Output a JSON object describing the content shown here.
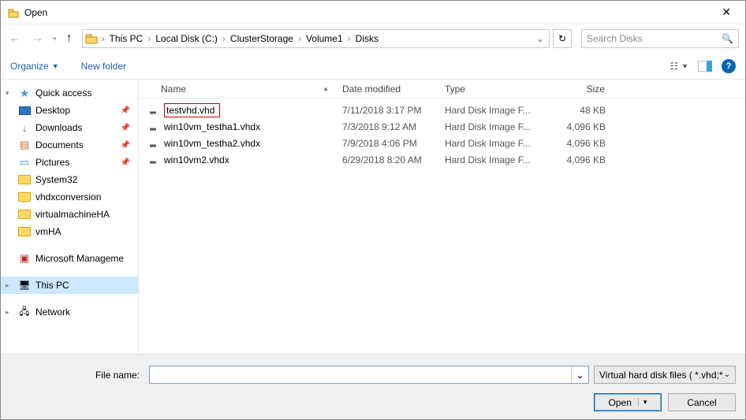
{
  "window": {
    "title": "Open"
  },
  "breadcrumb": [
    "This PC",
    "Local Disk (C:)",
    "ClusterStorage",
    "Volume1",
    "Disks"
  ],
  "search": {
    "placeholder": "Search Disks"
  },
  "toolbar": {
    "organize": "Organize",
    "newfolder": "New folder"
  },
  "tree": {
    "quick": {
      "label": "Quick access"
    },
    "desktop": {
      "label": "Desktop"
    },
    "downloads": {
      "label": "Downloads"
    },
    "documents": {
      "label": "Documents"
    },
    "pictures": {
      "label": "Pictures"
    },
    "system32": {
      "label": "System32"
    },
    "vhdx": {
      "label": "vhdxconversion"
    },
    "vmha": {
      "label": "virtualmachineHA"
    },
    "vmha2": {
      "label": "vmHA"
    },
    "mmc": {
      "label": "Microsoft Manageme"
    },
    "thispc": {
      "label": "This PC"
    },
    "network": {
      "label": "Network"
    }
  },
  "columns": {
    "name": "Name",
    "date": "Date modified",
    "type": "Type",
    "size": "Size"
  },
  "files": [
    {
      "name": "testvhd.vhd",
      "date": "7/11/2018 3:17 PM",
      "type": "Hard Disk Image F...",
      "size": "48 KB",
      "highlight": true
    },
    {
      "name": "win10vm_testha1.vhdx",
      "date": "7/3/2018 9:12 AM",
      "type": "Hard Disk Image F...",
      "size": "4,096 KB"
    },
    {
      "name": "win10vm_testha2.vhdx",
      "date": "7/9/2018 4:06 PM",
      "type": "Hard Disk Image F...",
      "size": "4,096 KB"
    },
    {
      "name": "win10vm2.vhdx",
      "date": "6/29/2018 8:20 AM",
      "type": "Hard Disk Image F...",
      "size": "4,096 KB"
    }
  ],
  "footer": {
    "filename_label": "File name:",
    "filename_value": "",
    "filter": "Virtual hard disk files  ( *.vhd;*.",
    "open": "Open",
    "cancel": "Cancel"
  }
}
